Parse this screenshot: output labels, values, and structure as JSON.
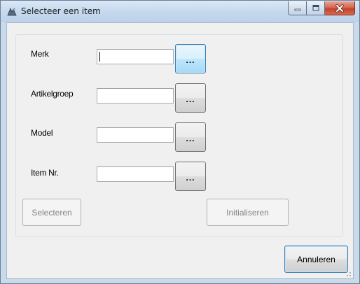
{
  "window": {
    "title": "Selecteer een item",
    "colors": {
      "title_bar": "#c6d9ee",
      "close_button": "#c4412a",
      "client_bg": "#f0f0f0",
      "focus_border": "#3c7fb1"
    }
  },
  "fields": [
    {
      "label": "Merk",
      "value": "",
      "browse_label": "...",
      "focused": true
    },
    {
      "label": "Artikelgroep",
      "value": "",
      "browse_label": "..."
    },
    {
      "label": "Model",
      "value": "",
      "browse_label": "..."
    },
    {
      "label": "Item Nr.",
      "value": "",
      "browse_label": "..."
    }
  ],
  "buttons": {
    "select": {
      "label": "Selecteren",
      "enabled": false
    },
    "initialize": {
      "label": "Initialiseren",
      "enabled": false
    },
    "cancel": {
      "label": "Annuleren",
      "enabled": true
    }
  },
  "icons": {
    "title": "app-icon",
    "minimize": "minimize-icon",
    "maximize": "maximize-icon",
    "close": "close-icon"
  }
}
